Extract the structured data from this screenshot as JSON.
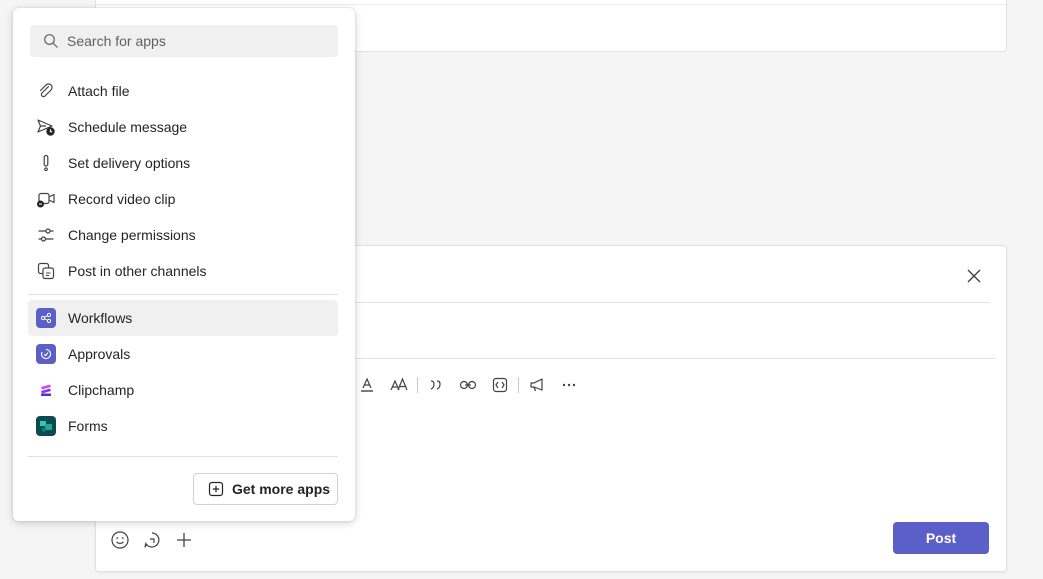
{
  "app_menu": {
    "search_placeholder": "Search for apps",
    "actions": [
      {
        "label": "Attach file",
        "icon": "paperclip-icon"
      },
      {
        "label": "Schedule message",
        "icon": "schedule-send-icon"
      },
      {
        "label": "Set delivery options",
        "icon": "exclamation-icon"
      },
      {
        "label": "Record video clip",
        "icon": "video-clip-icon"
      },
      {
        "label": "Change permissions",
        "icon": "sliders-icon"
      },
      {
        "label": "Post in other channels",
        "icon": "multi-channel-icon"
      }
    ],
    "apps": [
      {
        "label": "Workflows",
        "icon": "workflows-icon",
        "color": "#5b5fc7"
      },
      {
        "label": "Approvals",
        "icon": "approvals-icon",
        "color": "#5b5fc7"
      },
      {
        "label": "Clipchamp",
        "icon": "clipchamp-icon",
        "color": "#7b3fe4"
      },
      {
        "label": "Forms",
        "icon": "forms-icon",
        "color": "#077568"
      }
    ],
    "get_more_label": "Get more apps"
  },
  "compose": {
    "post_label": "Post",
    "accent": "#5b5fc7"
  }
}
